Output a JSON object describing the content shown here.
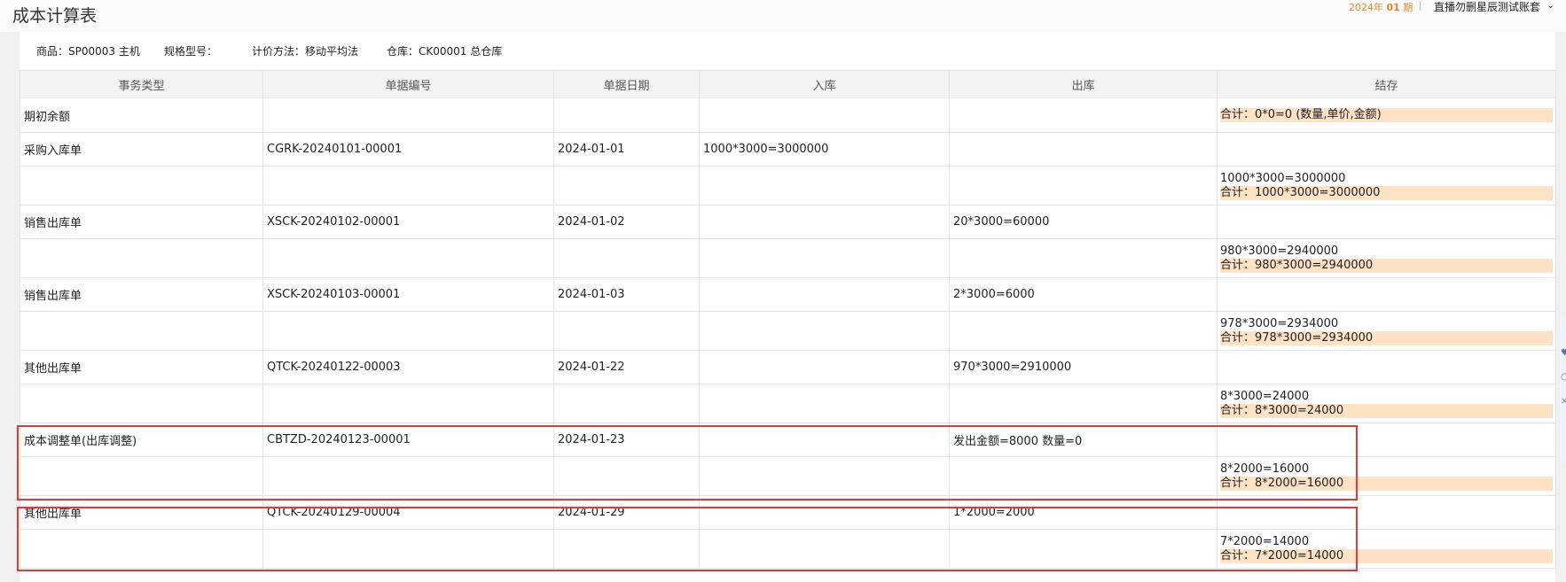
{
  "header": {
    "title": "成本计算表",
    "period_prefix": "2024年",
    "period_num": "01",
    "period_suffix": "期",
    "account": "直播勿删星辰测试账套",
    "chevron": "⌄"
  },
  "info": {
    "product": "商品：SP00003 主机",
    "spec": "规格型号：",
    "method": "计价方法：移动平均法",
    "warehouse": "仓库：CK00001 总仓库"
  },
  "table": {
    "headers": [
      "事务类型",
      "单据编号",
      "单据日期",
      "入库",
      "出库",
      "结存"
    ],
    "rows": [
      {
        "type": "期初余额",
        "no": "",
        "date": "",
        "in": "",
        "out": "",
        "stock": "",
        "sum": "合计：0*0=0 (数量,单价,金额)"
      },
      {
        "type": "采购入库单",
        "no": "CGRK-20240101-00001",
        "date": "2024-01-01",
        "in": "1000*3000=3000000",
        "out": "",
        "stock": "",
        "sum": ""
      },
      {
        "type": "",
        "no": "",
        "date": "",
        "in": "",
        "out": "",
        "stock": "1000*3000=3000000",
        "sum": "合计：1000*3000=3000000"
      },
      {
        "type": "销售出库单",
        "no": "XSCK-20240102-00001",
        "date": "2024-01-02",
        "in": "",
        "out": "20*3000=60000",
        "stock": "",
        "sum": ""
      },
      {
        "type": "",
        "no": "",
        "date": "",
        "in": "",
        "out": "",
        "stock": "980*3000=2940000",
        "sum": "合计：980*3000=2940000"
      },
      {
        "type": "销售出库单",
        "no": "XSCK-20240103-00001",
        "date": "2024-01-03",
        "in": "",
        "out": "2*3000=6000",
        "stock": "",
        "sum": ""
      },
      {
        "type": "",
        "no": "",
        "date": "",
        "in": "",
        "out": "",
        "stock": "978*3000=2934000",
        "sum": "合计：978*3000=2934000"
      },
      {
        "type": "其他出库单",
        "no": "QTCK-20240122-00003",
        "date": "2024-01-22",
        "in": "",
        "out": "970*3000=2910000",
        "stock": "",
        "sum": ""
      },
      {
        "type": "",
        "no": "",
        "date": "",
        "in": "",
        "out": "",
        "stock": "8*3000=24000",
        "sum": "合计：8*3000=24000"
      },
      {
        "type": "成本调整单(出库调整)",
        "no": "CBTZD-20240123-00001",
        "date": "2024-01-23",
        "in": "",
        "out": "发出金额=8000 数量=0",
        "stock": "",
        "sum": ""
      },
      {
        "type": "",
        "no": "",
        "date": "",
        "in": "",
        "out": "",
        "stock": "8*2000=16000",
        "sum": "合计：8*2000=16000"
      },
      {
        "type": "其他出库单",
        "no": "QTCK-20240129-00004",
        "date": "2024-01-29",
        "in": "",
        "out": "1*2000=2000",
        "stock": "",
        "sum": ""
      },
      {
        "type": "",
        "no": "",
        "date": "",
        "in": "",
        "out": "",
        "stock": "7*2000=14000",
        "sum": "合计：7*2000=14000"
      }
    ]
  },
  "edge_icons": [
    "heart-icon",
    "circle-icon",
    "close-icon"
  ],
  "colors": {
    "highlight": "#e53935",
    "sum_bg": "#fde2c6",
    "period": "#e0892d"
  }
}
